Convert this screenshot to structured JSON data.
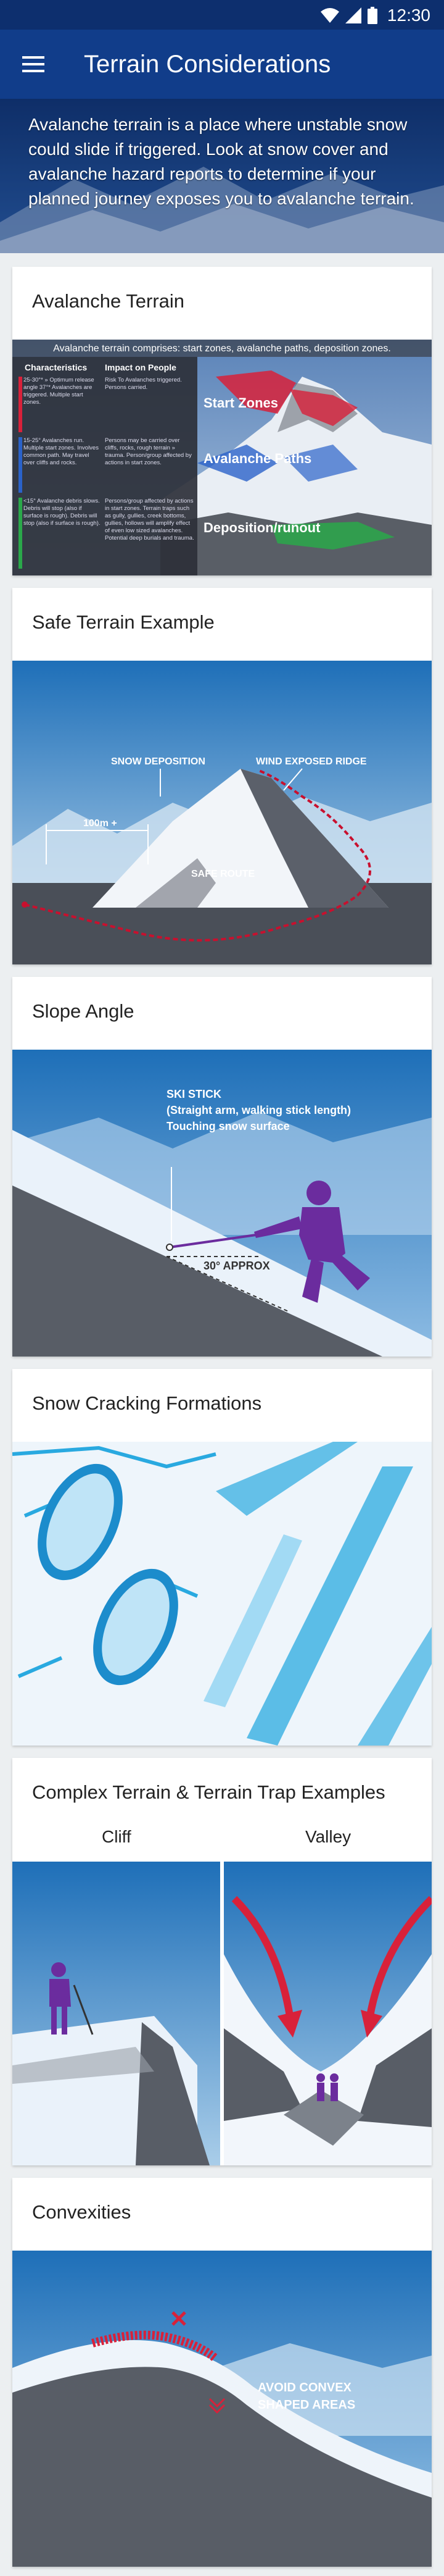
{
  "status_bar": {
    "time": "12:30",
    "icons": [
      "wifi-icon",
      "cell-signal-icon",
      "battery-icon"
    ]
  },
  "app_bar": {
    "title": "Terrain Considerations",
    "menu_icon": "hamburger-menu-icon"
  },
  "intro": {
    "text": "Avalanche terrain is a place where unstable snow could slide if triggered. Look at snow cover and avalanche hazard reports to determine if your planned journey exposes you to avalanche terrain."
  },
  "cards": {
    "avalanche_terrain": {
      "title": "Avalanche Terrain",
      "banner": "Avalanche terrain comprises: start zones, avalanche paths, deposition zones.",
      "table_headers": [
        "Characteristics",
        "Impact on People"
      ],
      "rows": [
        {
          "characteristics": "25-30°* » Optimum release angle 37°* Avalanches are triggered. Multiple start zones.",
          "impact": "Risk To Avalanches triggered. Persons carried."
        },
        {
          "characteristics": "15-25° Avalanches run. Multiple start zones. Involves common path. May travel over cliffs and rocks.",
          "impact": "Persons may be carried over cliffs, rocks, rough terrain » trauma. Person/group affected by actions in start zones."
        },
        {
          "characteristics": "<15° Avalanche debris slows. Debris will stop (also if surface is rough). Debris will stop (also if surface is rough).",
          "impact": "Persons/group affected by actions in start zones. Terrain traps such as gully, gullies, creek bottoms, gullies, hollows will amplify effect of even low sized avalanches. Potential deep burials and trauma."
        }
      ],
      "zones": [
        "Start Zones",
        "Avalanche Paths",
        "Deposition/runout"
      ],
      "zone_colors": [
        "#d8213a",
        "#2a62c9",
        "#2aa84a"
      ]
    },
    "safe_terrain": {
      "title": "Safe Terrain Example",
      "labels": {
        "snow_deposition": "SNOW DEPOSITION",
        "wind_ridge": "WIND EXPOSED RIDGE",
        "distance": "100m +",
        "safe_route": "SAFE ROUTE"
      },
      "route_color": "#c8102e"
    },
    "slope_angle": {
      "title": "Slope Angle",
      "labels": {
        "stick_line1": "SKI STICK",
        "stick_line2": "(Straight arm, walking stick length)",
        "stick_line3": "Touching snow surface",
        "angle": "30° APPROX"
      },
      "figure_color": "#6b2c9e"
    },
    "snow_cracking": {
      "title": "Snow Cracking Formations",
      "accent_color": "#29a9e0"
    },
    "complex_terrain": {
      "title": "Complex Terrain & Terrain Trap Examples",
      "columns": [
        "Cliff",
        "Valley"
      ],
      "arrow_color": "#d8213a"
    },
    "convexities": {
      "title": "Convexities",
      "labels": {
        "line1": "AVOID CONVEX",
        "line2": "SHAPED AREAS"
      },
      "warning_color": "#d8213a"
    }
  }
}
